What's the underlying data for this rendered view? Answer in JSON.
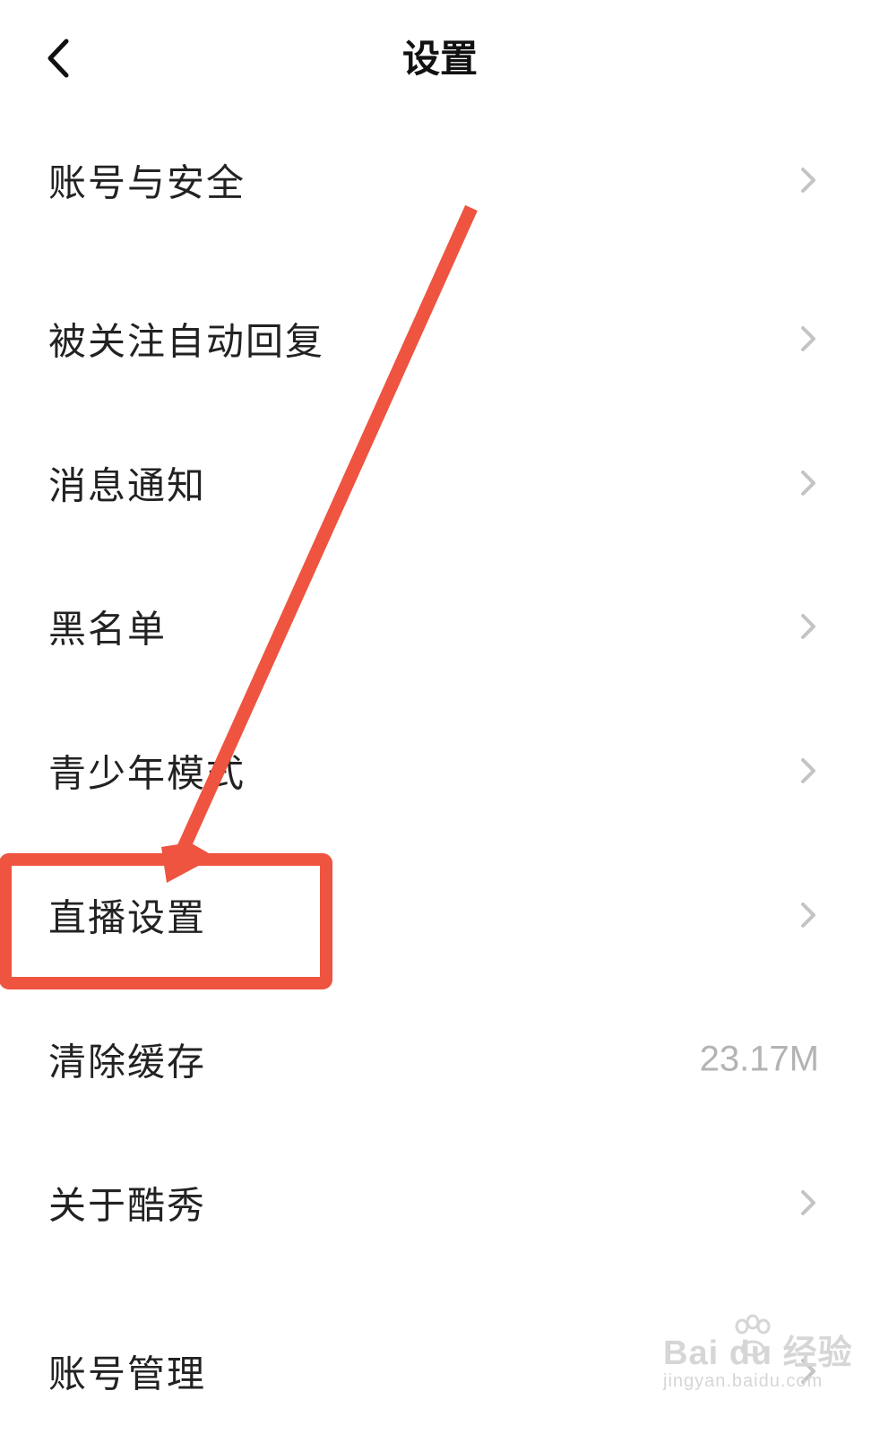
{
  "header": {
    "title": "设置",
    "back_icon": "chevron-left-icon"
  },
  "settings": {
    "items": [
      {
        "label": "账号与安全",
        "icon": "chevron-right-icon"
      },
      {
        "label": "被关注自动回复",
        "icon": "chevron-right-icon"
      },
      {
        "label": "消息通知",
        "icon": "chevron-right-icon"
      },
      {
        "label": "黑名单",
        "icon": "chevron-right-icon"
      },
      {
        "label": "青少年模式",
        "icon": "chevron-right-icon"
      },
      {
        "label": "直播设置",
        "icon": "chevron-right-icon"
      },
      {
        "label": "清除缓存",
        "value": "23.17M"
      },
      {
        "label": "关于酷秀",
        "icon": "chevron-right-icon"
      },
      {
        "label": "账号管理",
        "icon": "chevron-right-icon"
      }
    ]
  },
  "annotation": {
    "color": "#ee5440",
    "highlighted_item": "直播设置"
  },
  "watermark": {
    "brand": "Bai du 经验",
    "url": "jingyan.baidu.com"
  },
  "colors": {
    "text_primary": "#222222",
    "text_secondary": "#b3b3b3",
    "chevron": "#c4c4c4",
    "background": "#ffffff"
  }
}
